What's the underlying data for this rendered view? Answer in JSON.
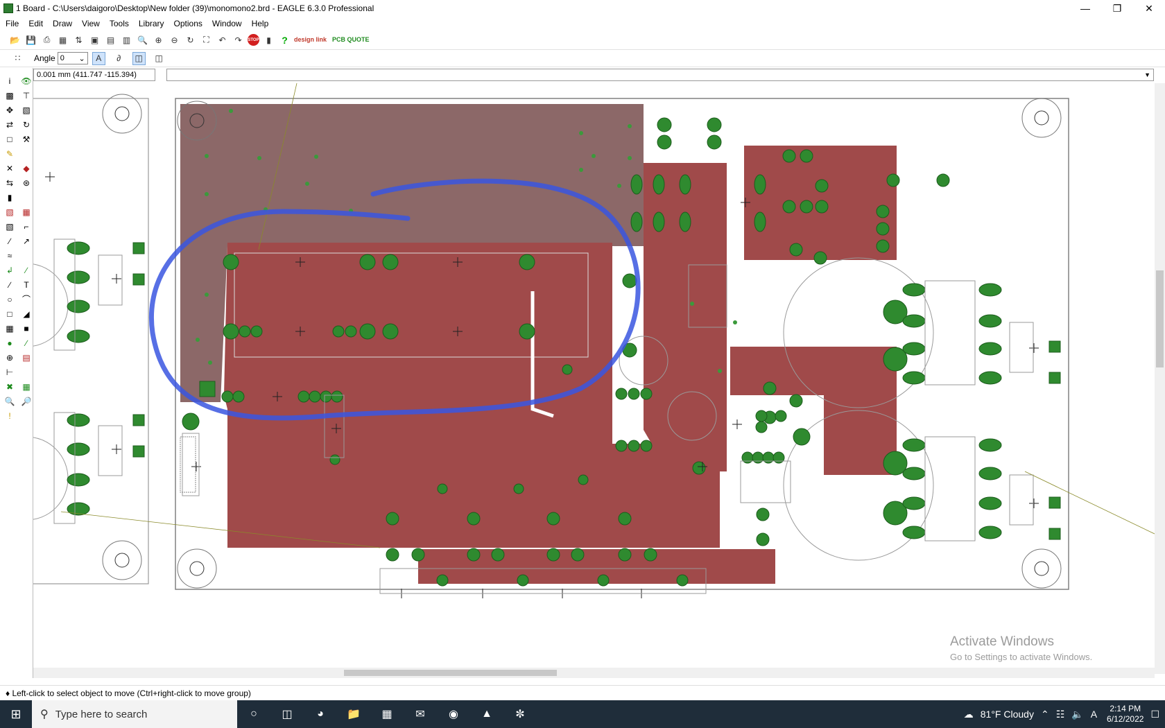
{
  "window": {
    "title": "1 Board - C:\\Users\\daigoro\\Desktop\\New folder (39)\\monomono2.brd - EAGLE 6.3.0 Professional",
    "controls": [
      "—",
      "❐",
      "✕"
    ]
  },
  "menu": {
    "items": [
      "File",
      "Edit",
      "Draw",
      "View",
      "Tools",
      "Library",
      "Options",
      "Window",
      "Help"
    ]
  },
  "toolbar": {
    "stop_label": "STOP",
    "designlink_label": "design link",
    "pcbquote_label": "PCB QUOTE"
  },
  "params": {
    "angle_label": "Angle",
    "angle_value": "0"
  },
  "command": {
    "coord_readout": "0.001 mm (411.747 -115.394)",
    "input_value": ""
  },
  "statusbar": {
    "message": "♦ Left-click to select object to move (Ctrl+right-click to move group)"
  },
  "watermark": {
    "line1": "Activate Windows",
    "line2": "Go to Settings to activate Windows."
  },
  "taskbar": {
    "search_placeholder": "Type here to search",
    "weather": "81°F  Cloudy",
    "time": "2:14 PM",
    "date": "6/12/2022"
  },
  "colors": {
    "copper_fill": "#a04a4a",
    "copper_area_dim": "#8c6868",
    "pad_green": "#2f8a2f",
    "annotation_blue": "#3a56e0",
    "outline_gray": "#9a9a9a"
  }
}
